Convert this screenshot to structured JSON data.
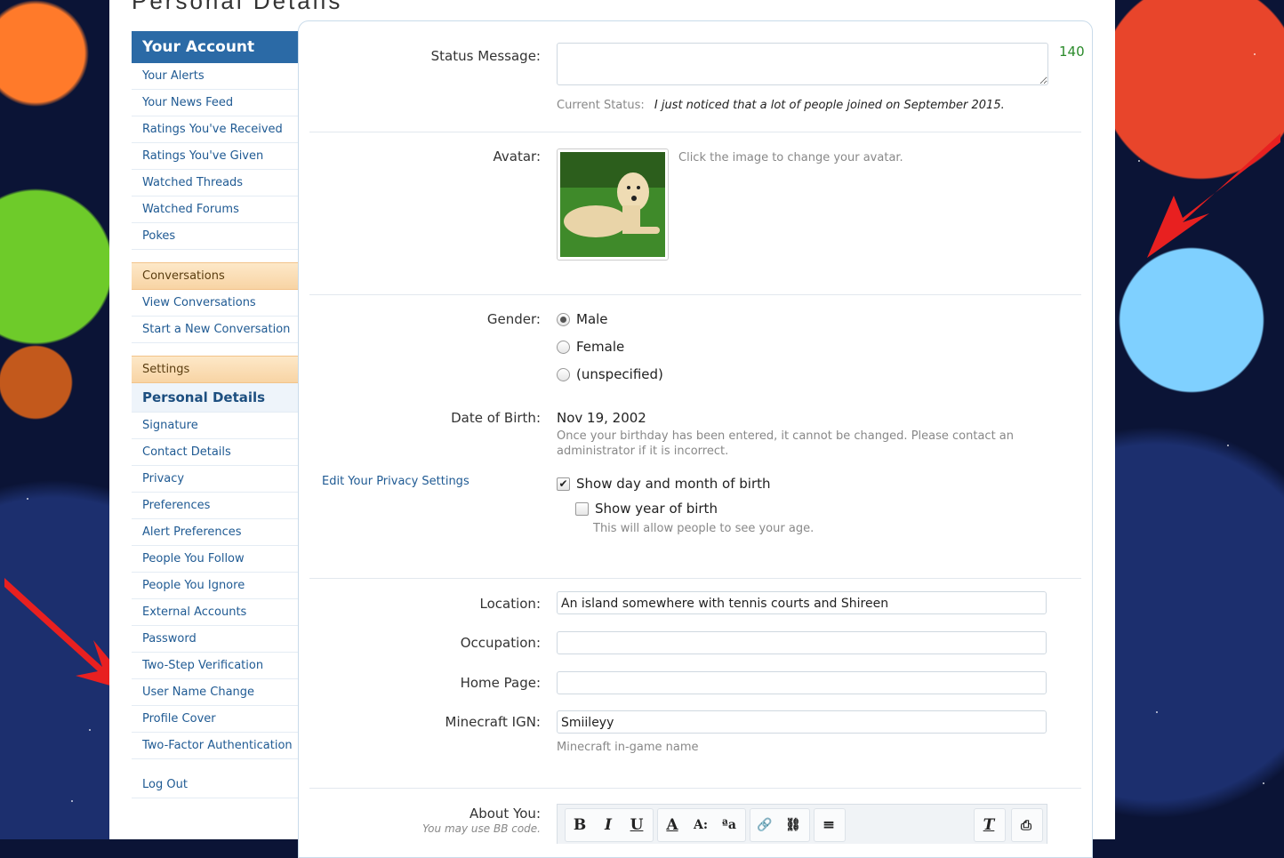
{
  "page": {
    "heading_fragment": "Personal Details"
  },
  "sidebar": {
    "header": "Your Account",
    "account_items": [
      "Your Alerts",
      "Your News Feed",
      "Ratings You've Received",
      "Ratings You've Given",
      "Watched Threads",
      "Watched Forums",
      "Pokes"
    ],
    "conversations_header": "Conversations",
    "conversation_items": [
      "View Conversations",
      "Start a New Conversation"
    ],
    "settings_header": "Settings",
    "active_item": "Personal Details",
    "settings_items": [
      "Signature",
      "Contact Details",
      "Privacy",
      "Preferences",
      "Alert Preferences",
      "People You Follow",
      "People You Ignore",
      "External Accounts",
      "Password",
      "Two-Step Verification",
      "User Name Change",
      "Profile Cover",
      "Two-Factor Authentication"
    ],
    "logout": "Log Out"
  },
  "form": {
    "status_label": "Status Message:",
    "status_counter": "140",
    "current_status_label": "Current Status:",
    "current_status_value": "I just noticed that a lot of people joined on September 2015.",
    "avatar_label": "Avatar:",
    "avatar_hint": "Click the image to change your avatar.",
    "gender_label": "Gender:",
    "gender_options": [
      "Male",
      "Female",
      "(unspecified)"
    ],
    "gender_selected": "Male",
    "dob_label": "Date of Birth:",
    "dob_value": "Nov 19, 2002",
    "dob_note": "Once your birthday has been entered, it cannot be changed. Please contact an administrator if it is incorrect.",
    "privacy_link": "Edit Your Privacy Settings",
    "show_day_month": "Show day and month of birth",
    "show_year": "Show year of birth",
    "show_year_note": "This will allow people to see your age.",
    "location_label": "Location:",
    "location_value": "An island somewhere with tennis courts and Shireen",
    "occupation_label": "Occupation:",
    "occupation_value": "",
    "homepage_label": "Home Page:",
    "homepage_value": "",
    "ign_label": "Minecraft IGN:",
    "ign_value": "Smiileyy",
    "ign_note": "Minecraft in-game name",
    "about_label": "About You:",
    "about_note": "You may use BB code."
  },
  "toolbar": {
    "bold": "B",
    "italic": "I",
    "underline": "U",
    "color": "A",
    "size": "A:",
    "font": "ªa",
    "link": "🔗",
    "unlink": "⛓",
    "align": "≡",
    "remove_format": "T",
    "extra": "⎙"
  },
  "colors": {
    "accent": "#2b6aa6",
    "section_bg": "#fde8c8",
    "counter": "#2a8a2a"
  }
}
